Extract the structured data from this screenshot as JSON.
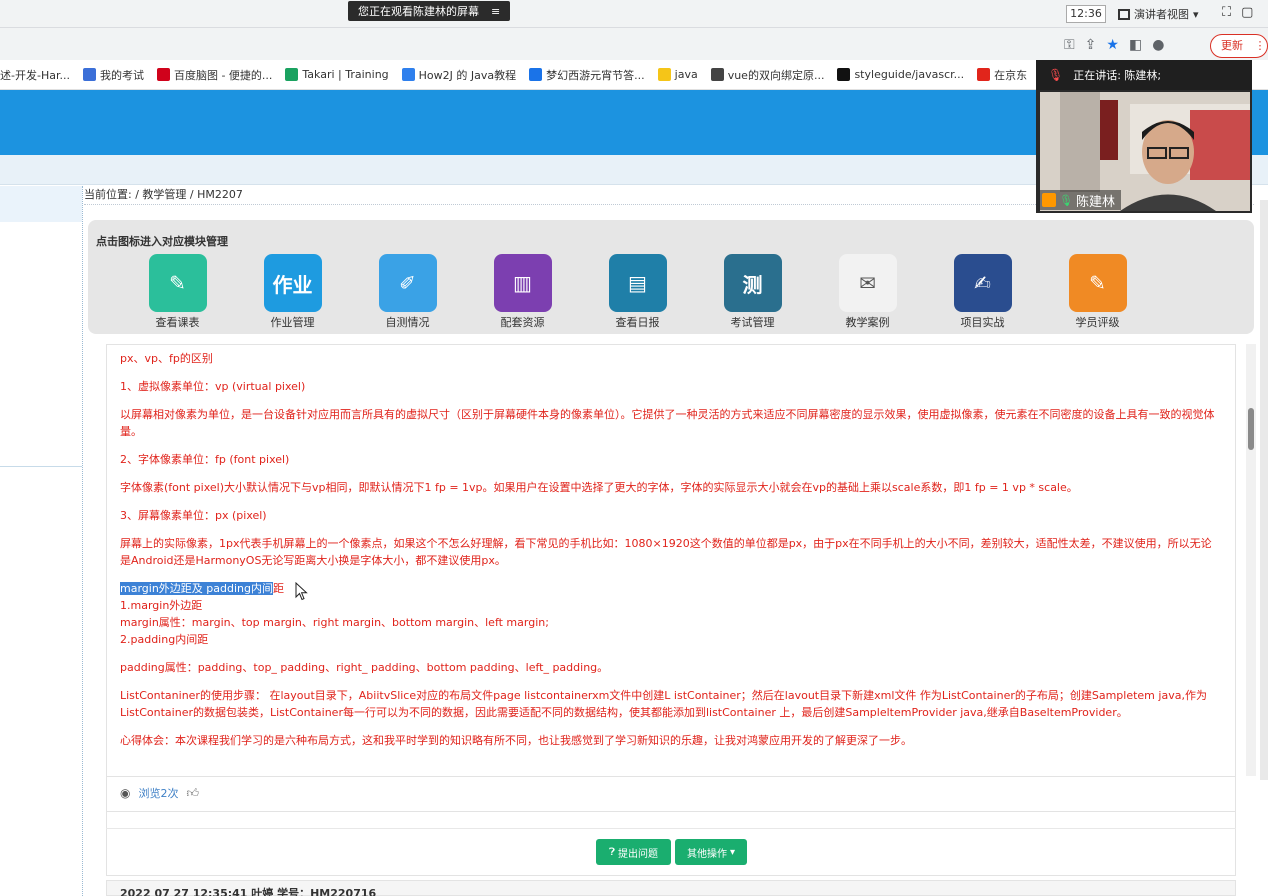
{
  "system": {
    "share_banner": "您正在观看陈建林的屏幕",
    "banner_menu_icon": "≡",
    "clock": "12:36",
    "present_view": "演讲者视图",
    "present_caret": "▾"
  },
  "browser": {
    "update_label": "更新",
    "bookmarks": [
      {
        "label": "述-开发-Har...",
        "icon": "none"
      },
      {
        "label": "我的考试",
        "icon": "exam-icon",
        "color": "#3b6fd8"
      },
      {
        "label": "百度脑图 - 便捷的...",
        "icon": "baidu-icon",
        "color": "#d0021b"
      },
      {
        "label": "Takari | Training",
        "icon": "takari-icon",
        "color": "#1aa260"
      },
      {
        "label": "How2J 的 Java教程",
        "icon": "how2j-icon",
        "color": "#2f80ed"
      },
      {
        "label": "梦幻西游元宵节答...",
        "icon": "search-icon",
        "color": "#1a73e8"
      },
      {
        "label": "java",
        "icon": "folder-icon",
        "color": "#f5c518"
      },
      {
        "label": "vue的双向绑定原...",
        "icon": "vue-icon",
        "color": "#444444"
      },
      {
        "label": "styleguide/javascr...",
        "icon": "github-icon",
        "color": "#111111"
      },
      {
        "label": "在京东",
        "icon": "jd-icon",
        "color": "#e1251b"
      }
    ]
  },
  "page": {
    "breadcrumb": "当前位置:  / 教学管理 / HM2207",
    "modules_title": "点击图标进入对应模块管理",
    "modules": [
      {
        "label": "查看课表",
        "icon": "schedule-icon",
        "color": "#2bbf9b",
        "glyph": "✎"
      },
      {
        "label": "作业管理",
        "icon": "homework-icon",
        "color": "#1e9be0",
        "glyph": "作业"
      },
      {
        "label": "自测情况",
        "icon": "selftest-icon",
        "color": "#3aa2e6",
        "glyph": "✐"
      },
      {
        "label": "配套资源",
        "icon": "resources-icon",
        "color": "#7c3fb0",
        "glyph": "▥"
      },
      {
        "label": "查看日报",
        "icon": "daily-report-icon",
        "color": "#1f7fa8",
        "glyph": "▤"
      },
      {
        "label": "考试管理",
        "icon": "exam-manage-icon",
        "color": "#2a6f8e",
        "glyph": "测"
      },
      {
        "label": "教学案例",
        "icon": "teaching-case-icon",
        "color": "#f2f2f2",
        "glyph": "✉"
      },
      {
        "label": "项目实战",
        "icon": "project-icon",
        "color": "#2a4d8f",
        "glyph": "✍"
      },
      {
        "label": "学员评级",
        "icon": "rating-icon",
        "color": "#f08a24",
        "glyph": "✎"
      }
    ],
    "content": {
      "p1": "px、vp、fp的区别",
      "p2": "1、虚拟像素单位：vp (virtual pixel)",
      "p3": "以屏幕相对像素为单位，是一台设备针对应用而言所具有的虚拟尺寸（区别于屏幕硬件本身的像素单位）。它提供了一种灵活的方式来适应不同屏幕密度的显示效果，使用虚拟像素，使元素在不同密度的设备上具有一致的视觉体量。",
      "p4": "2、字体像素单位：fp (font pixel)",
      "p5": "字体像素(font pixel)大小默认情况下与vp相同，即默认情况下1 fp = 1vp。如果用户在设置中选择了更大的字体，字体的实际显示大小就会在vp的基础上乘以scale系数，即1 fp = 1 vp * scale。",
      "p6": "3、屏幕像素单位：px (pixel)",
      "p7": "屏幕上的实际像素，1px代表手机屏幕上的一个像素点，如果这个不怎么好理解，看下常见的手机比如：1080×1920这个数值的单位都是px，由于px在不同手机上的大小不同，差别较大，适配性太差，不建议使用，所以无论是Android还是HarmonyOS无论写距离大小换是字体大小，都不建议使用px。",
      "p8_selected": "margin外边距及 padding内间",
      "p8_rest": "距",
      "p9": "1.margin外边距",
      "p10": "margin属性：margin、top margin、right margin、bottom margin、left margin;",
      "p11": "2.padding内间距",
      "p12": "padding属性：padding、top_ padding、right_ padding、bottom padding、left_ padding。",
      "p13": "ListContaniner的使用步骤： 在layout目录下，AbiitvSlice对应的布局文件page listcontainerxm文件中创建L istContainer；然后在lavout目录下新建xml文件 作为ListContainer的子布局；创建Sampletem java,作为ListContainer的数据包装类，ListContainer每一行可以为不同的数据，因此需要适配不同的数据结构，使其都能添加到listContainer 上，最后创建SampleltemProvider java,继承自BaseltemProvider。",
      "p14": "心得体会：本次课程我们学习的是六种布局方式，这和我平时学到的知识略有所不同，也让我感觉到了学习新知识的乐趣，让我对鸿蒙应用开发的了解更深了一步。"
    },
    "views_text": "浏览2次",
    "ask_button": "提出问题",
    "other_button": "其他操作",
    "next_entry": "2022 07 27 12:35:41  叶婷  学号：HM220716"
  },
  "video": {
    "speaking_label": "正在讲话: 陈建林;",
    "participant_name": "陈建林"
  },
  "colors": {
    "header_blue": "#1c93e0",
    "content_red": "#e0231b",
    "button_green": "#1aae6f",
    "selection_blue": "#3d82d6"
  }
}
